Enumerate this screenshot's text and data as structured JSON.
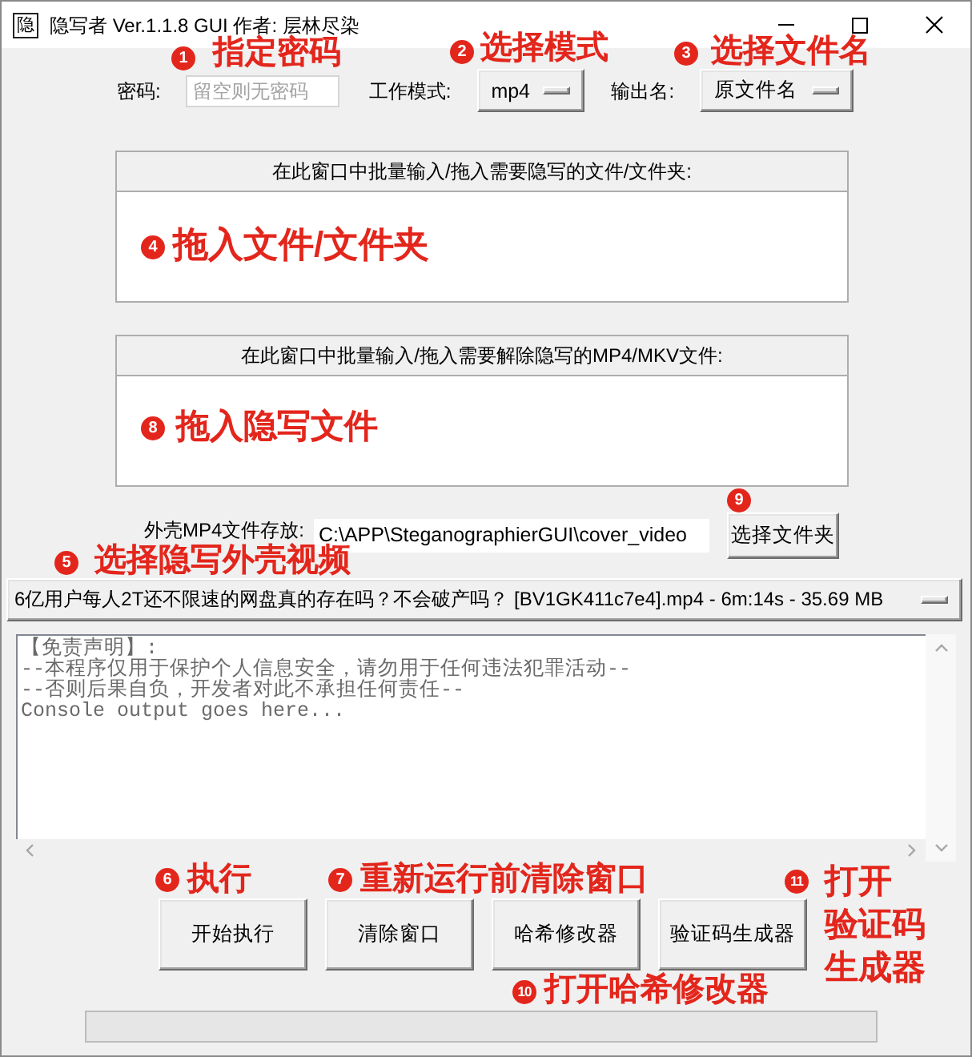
{
  "window": {
    "icon_text": "隐",
    "title": "隐写者 Ver.1.1.8 GUI 作者: 层林尽染"
  },
  "settings": {
    "password": {
      "label": "密码:",
      "placeholder": "留空则无密码"
    },
    "mode": {
      "label": "工作模式:",
      "value": "mp4"
    },
    "output_name": {
      "label": "输出名:",
      "value": "原文件名"
    }
  },
  "drop_areas": [
    {
      "label": "在此窗口中批量输入/拖入需要隐写的文件/文件夹:"
    },
    {
      "label": "在此窗口中批量输入/拖入需要解除隐写的MP4/MKV文件:"
    }
  ],
  "cover_video": {
    "label": "外壳MP4文件存放:",
    "path": "C:\\APP\\SteganographierGUI\\cover_video",
    "button": "选择文件夹",
    "selected_video": "6亿用户每人2T还不限速的网盘真的存在吗？不会破产吗？ [BV1GK411c7e4].mp4 - 6m:14s - 35.69 MB"
  },
  "console": {
    "lines": [
      "【免责声明】:",
      "--本程序仅用于保护个人信息安全，请勿用于任何违法犯罪活动--",
      "--否则后果自负，开发者对此不承担任何责任--",
      "Console output goes here..."
    ]
  },
  "buttons": [
    "开始执行",
    "清除窗口",
    "哈希修改器",
    "验证码生成器"
  ],
  "progress": {
    "level": 0
  },
  "annotations": [
    {
      "number": "1",
      "text": "指定密码"
    },
    {
      "number": "2",
      "text": "选择模式"
    },
    {
      "number": "3",
      "text": "选择文件名"
    },
    {
      "number": "4",
      "text": "拖入文件/文件夹"
    },
    {
      "number": "5",
      "text": "选择隐写外壳视频"
    },
    {
      "number": "6",
      "text": "执行"
    },
    {
      "number": "7",
      "text": "重新运行前清除窗口"
    },
    {
      "number": "8",
      "text": "拖入隐写文件"
    },
    {
      "number": "9"
    },
    {
      "number": "10",
      "text": "打开哈希修改器"
    },
    {
      "number": "11",
      "lines": [
        "打开",
        "验证码",
        "生成器"
      ]
    }
  ]
}
